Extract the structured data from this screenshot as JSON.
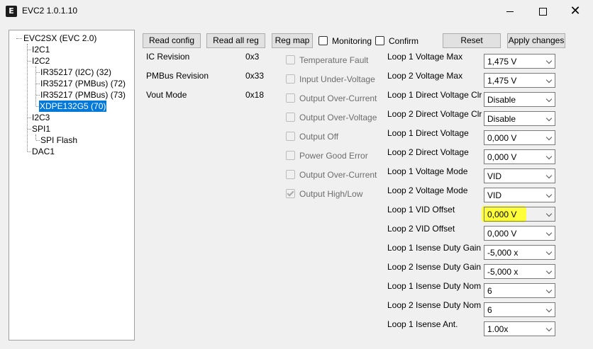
{
  "window": {
    "title": "EVC2 1.0.1.10",
    "icon_letter": "E"
  },
  "tree": {
    "root": "EVC2SX (EVC 2.0)",
    "i2c1": "I2C1",
    "i2c2": "I2C2",
    "dev1": "IR35217 (I2C) (32)",
    "dev2": "IR35217 (PMBus) (72)",
    "dev3": "IR35217 (PMBus) (73)",
    "dev4": "XDPE132G5 (70)",
    "i2c3": "I2C3",
    "spi1": "SPI1",
    "spiflash": "SPI Flash",
    "dac1": "DAC1"
  },
  "toolbar": {
    "read_config": "Read config",
    "read_all_reg": "Read all reg",
    "reg_map": "Reg map",
    "monitoring": "Monitoring",
    "confirm": "Confirm",
    "reset": "Reset",
    "apply": "Apply changes"
  },
  "info": [
    {
      "label": "IC Revision",
      "value": "0x3"
    },
    {
      "label": "PMBus Revision",
      "value": "0x33"
    },
    {
      "label": "Vout Mode",
      "value": "0x18"
    }
  ],
  "flags": [
    {
      "label": "Temperature Fault",
      "checked": false
    },
    {
      "label": "Input Under-Voltage",
      "checked": false
    },
    {
      "label": "Output Over-Current",
      "checked": false
    },
    {
      "label": "Output Over-Voltage",
      "checked": false
    },
    {
      "label": "Output Off",
      "checked": false
    },
    {
      "label": "Power Good Error",
      "checked": false
    },
    {
      "label": "Output Over-Current",
      "checked": false
    },
    {
      "label": "Output High/Low",
      "checked": true
    }
  ],
  "params": [
    {
      "label": "Loop 1 Voltage Max",
      "value": "1,475 V"
    },
    {
      "label": "Loop 2 Voltage Max",
      "value": "1,475 V"
    },
    {
      "label": "Loop 1 Direct Voltage Clr",
      "value": "Disable"
    },
    {
      "label": "Loop 2 Direct Voltage Clr",
      "value": "Disable"
    },
    {
      "label": "Loop 1 Direct Voltage",
      "value": "0,000 V"
    },
    {
      "label": "Loop 2 Direct Voltage",
      "value": "0,000 V"
    },
    {
      "label": "Loop 1 Voltage Mode",
      "value": "VID"
    },
    {
      "label": "Loop 2 Voltage Mode",
      "value": "VID"
    },
    {
      "label": "Loop 1 VID Offset",
      "value": "0,000 V"
    },
    {
      "label": "Loop 2 VID Offset",
      "value": "0,000 V"
    },
    {
      "label": "Loop 1 Isense Duty Gain",
      "value": "-5,000 x"
    },
    {
      "label": "Loop 2 Isense Duty Gain",
      "value": "-5,000 x"
    },
    {
      "label": "Loop 1 Isense Duty Nom",
      "value": "6"
    },
    {
      "label": "Loop 2 Isense Duty Nom",
      "value": "6"
    },
    {
      "label": "Loop 1 Isense Ant.",
      "value": "1.00x"
    }
  ],
  "colors": {
    "selection": "#0078d7",
    "highlight": "#ffff3a"
  }
}
